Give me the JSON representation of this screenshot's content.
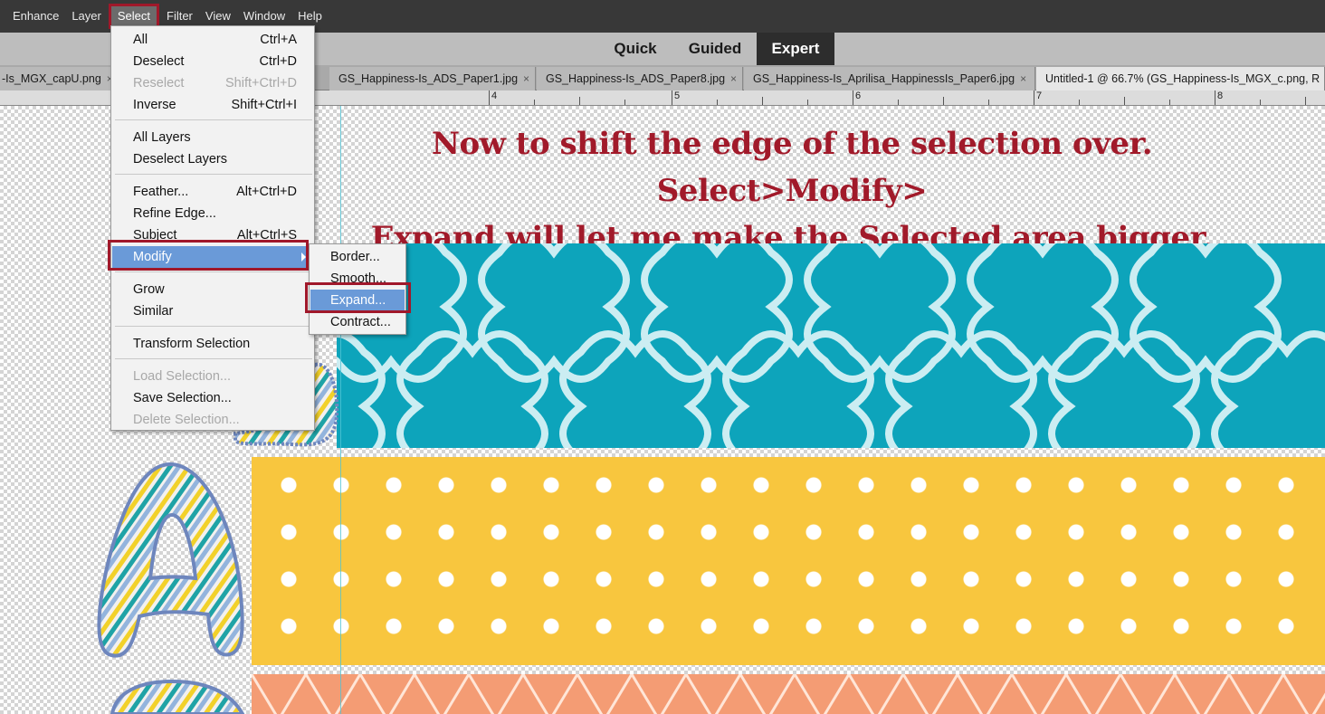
{
  "menubar": {
    "items": [
      "Enhance",
      "Layer",
      "Select",
      "Filter",
      "View",
      "Window",
      "Help"
    ],
    "active_index": 2
  },
  "modes": {
    "quick": "Quick",
    "guided": "Guided",
    "expert": "Expert",
    "active": "Expert"
  },
  "tabs": [
    {
      "label": "-Is_MGX_capU.png",
      "close": "×"
    },
    {
      "label": "GS_Happiness-Is_ADS_Paper1.jpg",
      "close": "×"
    },
    {
      "label": "GS_Happiness-Is_ADS_Paper8.jpg",
      "close": "×"
    },
    {
      "label": "GS_Happiness-Is_Aprilisa_HappinessIs_Paper6.jpg",
      "close": "×"
    },
    {
      "label": "Untitled-1 @ 66.7% (GS_Happiness-Is_MGX_c.png, R"
    }
  ],
  "ruler": {
    "numbers": [
      "4",
      "5",
      "6",
      "7",
      "8"
    ]
  },
  "annotation": {
    "line1": "Now to shift the edge of the selection over. Select>Modify>",
    "line2": "Expand will let me make the Selected area bigger."
  },
  "select_menu": {
    "items": [
      {
        "label": "All",
        "shortcut": "Ctrl+A",
        "enabled": true
      },
      {
        "label": "Deselect",
        "shortcut": "Ctrl+D",
        "enabled": true
      },
      {
        "label": "Reselect",
        "shortcut": "Shift+Ctrl+D",
        "enabled": false
      },
      {
        "label": "Inverse",
        "shortcut": "Shift+Ctrl+I",
        "enabled": true
      },
      {
        "label": "All Layers",
        "shortcut": "",
        "enabled": true
      },
      {
        "label": "Deselect Layers",
        "shortcut": "",
        "enabled": true
      },
      {
        "label": "Feather...",
        "shortcut": "Alt+Ctrl+D",
        "enabled": true
      },
      {
        "label": "Refine Edge...",
        "shortcut": "",
        "enabled": true
      },
      {
        "label": "Subject",
        "shortcut": "Alt+Ctrl+S",
        "enabled": true
      },
      {
        "label": "Modify",
        "shortcut": "",
        "enabled": true,
        "highlighted": true,
        "submenu": true
      },
      {
        "label": "Grow",
        "shortcut": "",
        "enabled": true
      },
      {
        "label": "Similar",
        "shortcut": "",
        "enabled": true
      },
      {
        "label": "Transform Selection",
        "shortcut": "",
        "enabled": true
      },
      {
        "label": "Load Selection...",
        "shortcut": "",
        "enabled": false
      },
      {
        "label": "Save Selection...",
        "shortcut": "",
        "enabled": true
      },
      {
        "label": "Delete Selection...",
        "shortcut": "",
        "enabled": false
      }
    ]
  },
  "modify_submenu": {
    "items": [
      {
        "label": "Border...",
        "highlighted": false
      },
      {
        "label": "Smooth...",
        "highlighted": false
      },
      {
        "label": "Expand...",
        "highlighted": true
      },
      {
        "label": "Contract...",
        "highlighted": false
      }
    ]
  },
  "colors": {
    "annotation": "#a11a2a",
    "highlight_box": "#a0182a",
    "menu_highlight": "#6a9ad8",
    "teal_paper": "#0da4bb",
    "yellow_paper": "#f8c63e",
    "orange_paper": "#f49c74"
  }
}
